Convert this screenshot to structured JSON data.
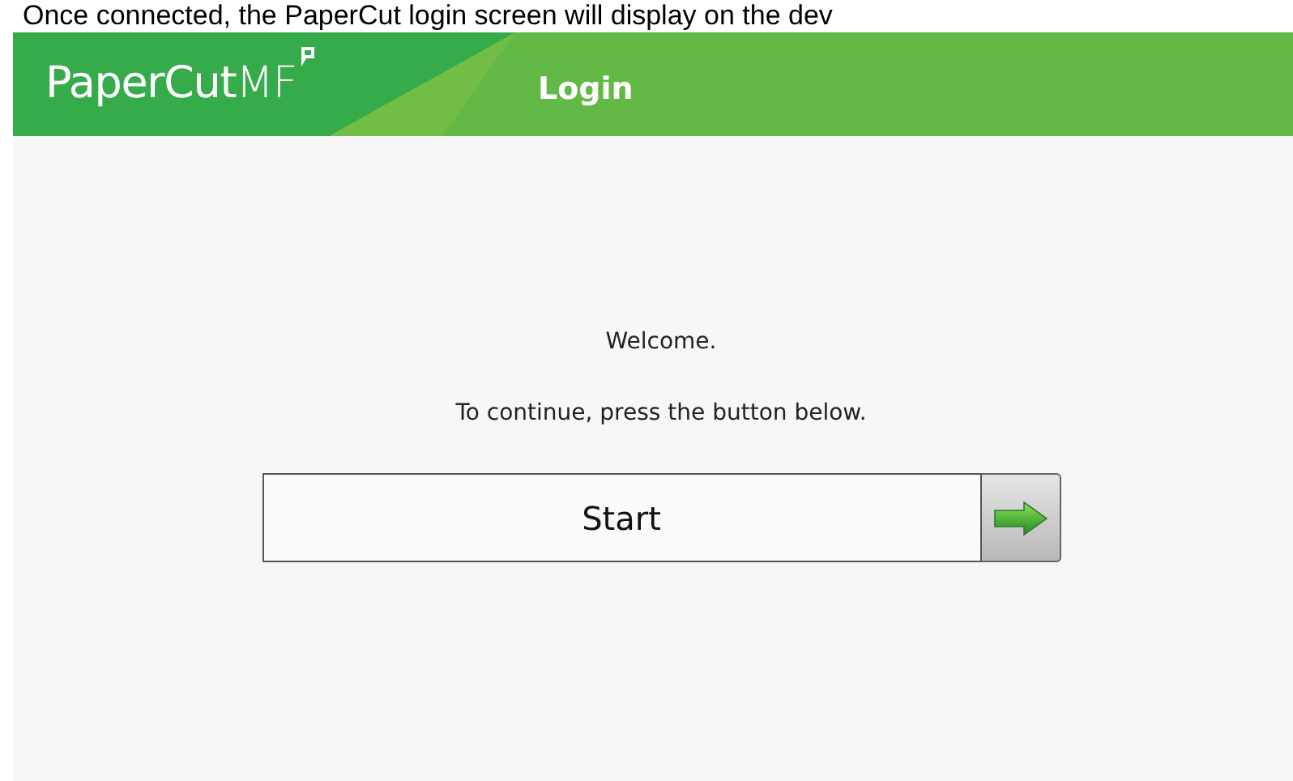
{
  "caption": "Once connected, the PaperCut login screen will display on the dev",
  "header": {
    "logo": {
      "name": "PaperCut",
      "suffix": "MF"
    },
    "title": "Login"
  },
  "welcome": "Welcome.",
  "instruction": "To continue, press the button below.",
  "start_button": {
    "label": "Start"
  }
}
